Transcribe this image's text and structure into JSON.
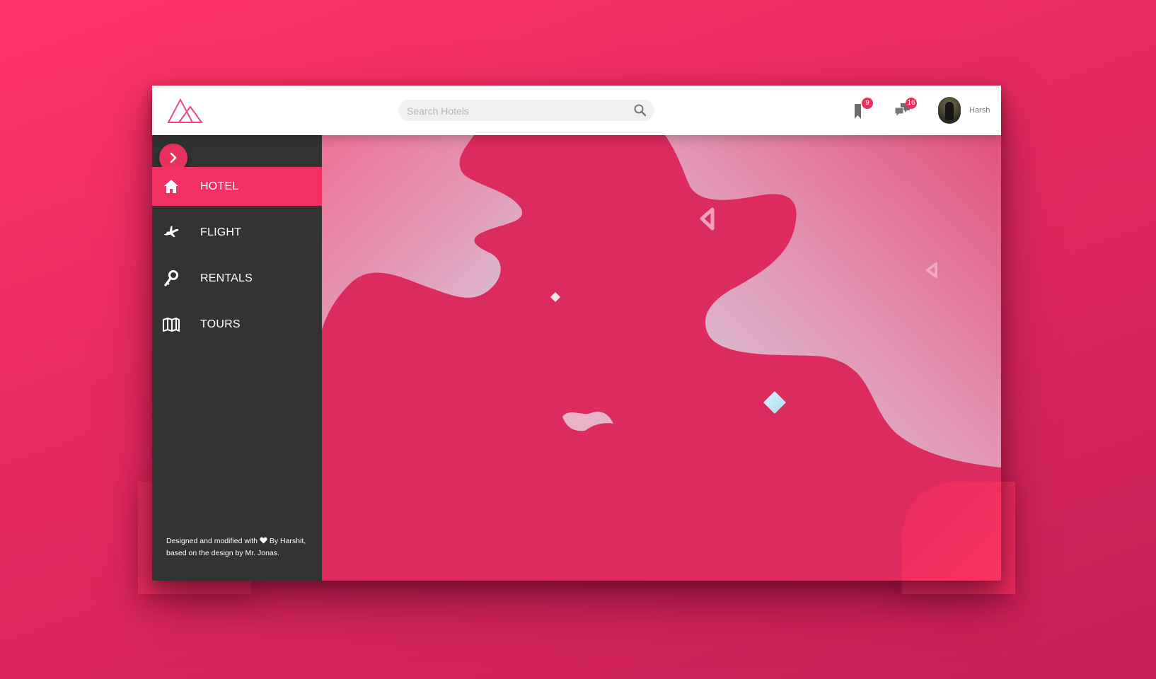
{
  "header": {
    "search": {
      "placeholder": "Search Hotels"
    },
    "bookmarks": {
      "count": "9"
    },
    "messages": {
      "count": "16"
    },
    "user": {
      "name": "Harsh"
    }
  },
  "sidebar": {
    "items": [
      {
        "label": "HOTEL",
        "icon": "home-icon",
        "active": true
      },
      {
        "label": "FLIGHT",
        "icon": "plane-icon",
        "active": false
      },
      {
        "label": "RENTALS",
        "icon": "key-icon",
        "active": false
      },
      {
        "label": "TOURS",
        "icon": "map-icon",
        "active": false
      }
    ],
    "credits": {
      "line1": "Designed and modified with",
      "line1_after": "By Harshit,",
      "line2": "based on the design by Mr. Jonas."
    }
  },
  "colors": {
    "accent": "#e8305f",
    "sidebar": "#333333",
    "background": "#dc2b5e"
  }
}
